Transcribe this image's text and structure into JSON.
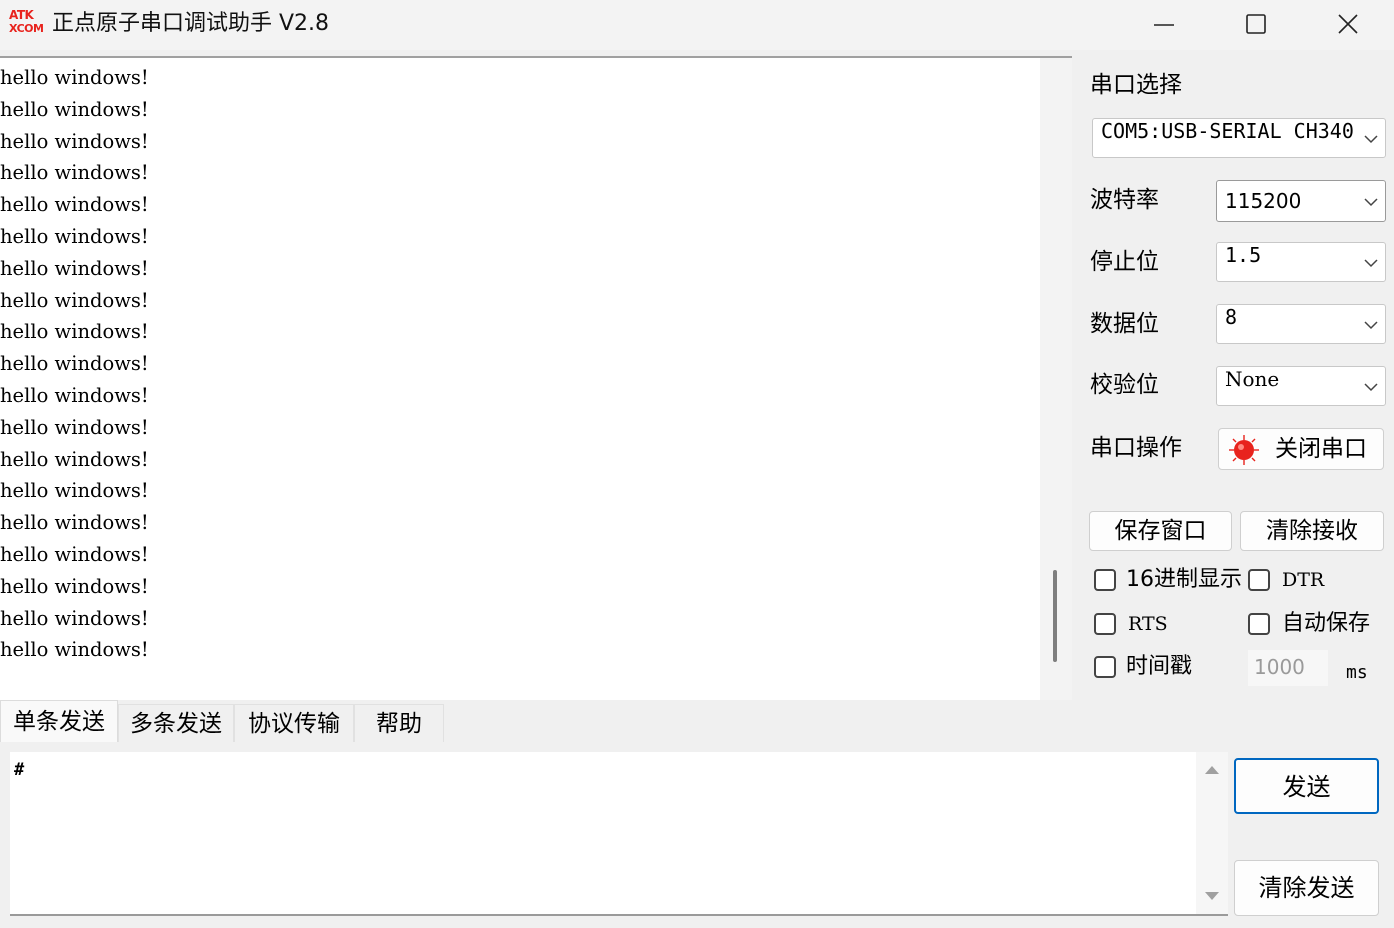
{
  "window": {
    "title": "正点原子串口调试助手 V2.8",
    "logo_line1": "ATK",
    "logo_line2": "XCOM"
  },
  "receive": {
    "lines": [
      "hello windows!",
      "hello windows!",
      "hello windows!",
      "hello windows!",
      "hello windows!",
      "hello windows!",
      "hello windows!",
      "hello windows!",
      "hello windows!",
      "hello windows!",
      "hello windows!",
      "hello windows!",
      "hello windows!",
      "hello windows!",
      "hello windows!",
      "hello windows!",
      "hello windows!",
      "hello windows!",
      "hello windows!"
    ]
  },
  "serial": {
    "port_label": "串口选择",
    "port_value": "COM5:USB-SERIAL CH340",
    "baud_label": "波特率",
    "baud_value": "115200",
    "stopbits_label": "停止位",
    "stopbits_value": "1.5",
    "databits_label": "数据位",
    "databits_value": "8",
    "parity_label": "校验位",
    "parity_value": "None",
    "operation_label": "串口操作",
    "close_port_label": "关闭串口",
    "status_color": "#e8231d"
  },
  "actions": {
    "save_window": "保存窗口",
    "clear_receive": "清除接收"
  },
  "options": {
    "hex_display": "16进制显示",
    "dtr": "DTR",
    "rts": "RTS",
    "auto_save": "自动保存",
    "timestamp": "时间戳",
    "interval_value": "1000",
    "interval_unit": "ms"
  },
  "tabs": [
    "单条发送",
    "多条发送",
    "协议传输",
    "帮助"
  ],
  "send": {
    "text": "#",
    "send_label": "发送",
    "clear_send_label": "清除发送",
    "accent_color": "#0067c0"
  }
}
